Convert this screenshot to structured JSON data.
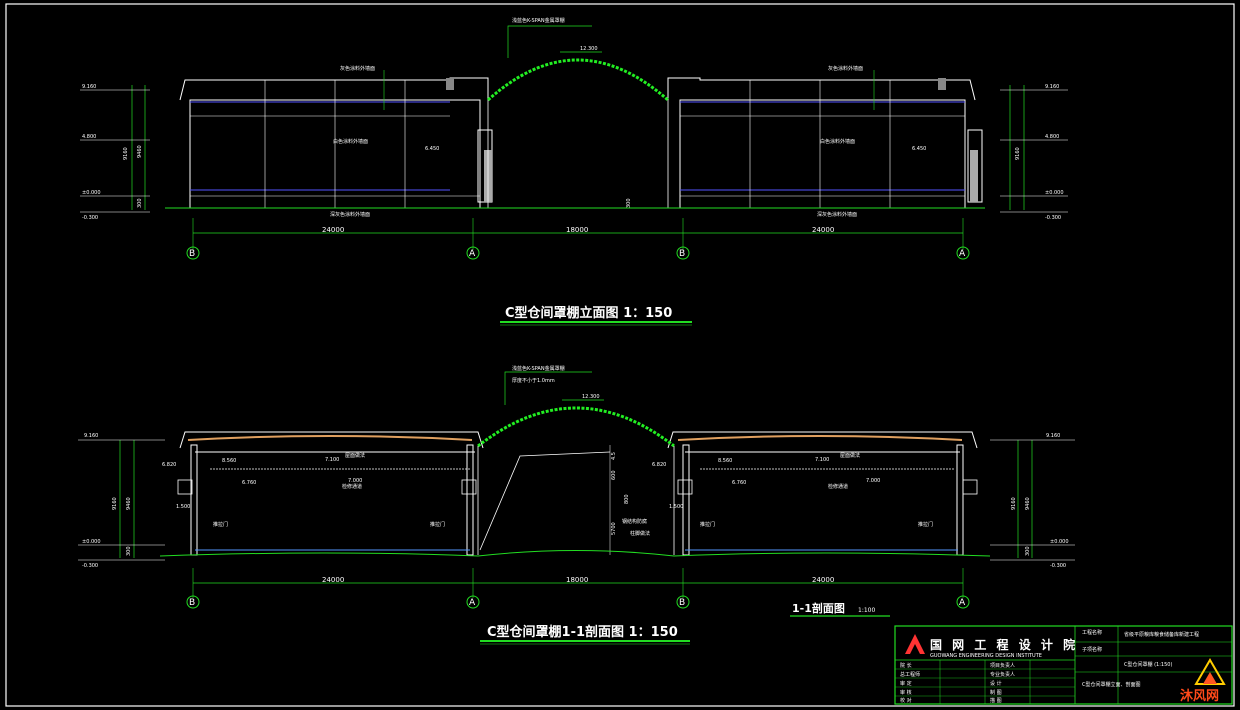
{
  "colors": {
    "background": "#000000",
    "wall": "#ffffff",
    "dimension": "#22dd22",
    "arch": "#22ee22",
    "blue_line": "#5555ff",
    "roof": "#e0a060",
    "watermark": "#ff5522"
  },
  "elevation": {
    "title": "C型仓间罩棚立面图  1：150",
    "arch_note": "浅蓝色K-SPAN金属罩棚",
    "arch_level": "12.300",
    "top_note_left": "灰色涂料外墙面",
    "top_note_right": "灰色涂料外墙面",
    "mid_note_left": "白色涂料外墙面",
    "mid_note_right": "白色涂料外墙面",
    "bottom_note_left": "深灰色涂料外墙面",
    "bottom_note_right": "深灰色涂料外墙面",
    "levels_left": [
      "9.160",
      "4.800",
      "±0.000",
      "-0.300"
    ],
    "levels_right": [
      "9.160",
      "4.800",
      "±0.000",
      "-0.300"
    ],
    "dims_vertical": [
      "9160",
      "9460",
      "300"
    ],
    "stair_level_left": "6.450",
    "stair_level_right": "6.450",
    "spans": [
      "24000",
      "18000",
      "24000"
    ],
    "axes": [
      "B",
      "A",
      "B",
      "A"
    ]
  },
  "section": {
    "title": "C型仓间罩棚1-1剖面图  1：150",
    "subtitle": "1-1剖面图",
    "subtitle_scale": "1:100",
    "arch_note": "浅蓝色K-SPAN金属罩棚",
    "arch_note2": "厚度不小于1.0mm",
    "arch_level": "12.300",
    "left_top_level": "9.160",
    "right_top_level": "9.160",
    "level_labels": [
      "6.820",
      "8.560",
      "7.100",
      "6.760",
      "7.000",
      "1.500"
    ],
    "roof_note": "屋面做法",
    "door_note": "推拉门",
    "pipe_note": "检修通道",
    "arch_dims": [
      "4.5",
      "600",
      "800",
      "5700"
    ],
    "arch_side_notes": [
      "钢结构防腐",
      "柱脚做法"
    ],
    "levels_bottom": [
      "±0.000",
      "-0.300"
    ],
    "dims_vertical": [
      "9160",
      "9460",
      "300"
    ],
    "spans": [
      "24000",
      "18000",
      "24000"
    ],
    "axes": [
      "B",
      "A",
      "B",
      "A"
    ]
  },
  "title_block": {
    "company": "国 网 工 程 设 计 院",
    "company_en": "GUOWANG ENGINEERING DESIGN INSTITUTE",
    "project_label": "工程名称",
    "project_name": "省级平原粮库粮食储备库新建工程",
    "sub_label": "子项名称",
    "drawing_title": "C型仓间罩棚 (1:150)",
    "drawing_content": "C型仓间罩棚立面、剖面图",
    "rows_left": [
      "院 长",
      "总工程师",
      "审 定",
      "审 核",
      "校 对"
    ],
    "rows_right": [
      "项目负责人",
      "专业负责人",
      "设 计",
      "制 图",
      "描 图"
    ],
    "watermark": "沐风网"
  }
}
